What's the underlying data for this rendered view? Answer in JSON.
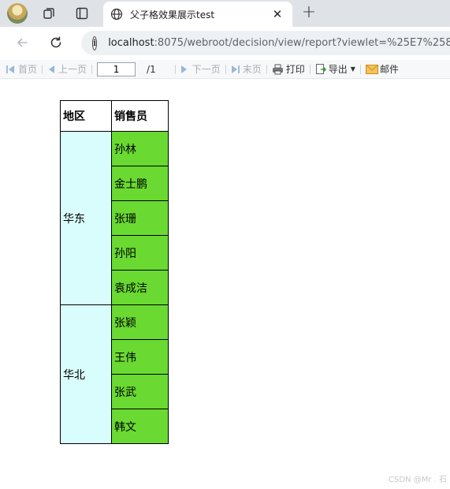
{
  "browser": {
    "tab_title": "父子格效果展示test",
    "tab_close": "✕",
    "new_tab": "+",
    "url_host": "localhost",
    "url_rest": ":8075/webroot/decision/view/report?viewlet=%25E7%2588%"
  },
  "toolbar": {
    "first": "首页",
    "prev": "上一页",
    "page_value": "1",
    "page_total": "/1",
    "next": "下一页",
    "last": "末页",
    "print": "打印",
    "export": "导出",
    "email": "邮件"
  },
  "report": {
    "headers": {
      "region": "地区",
      "seller": "销售员"
    },
    "groups": [
      {
        "region": "华东",
        "sellers": [
          "孙林",
          "金士鹏",
          "张珊",
          "孙阳",
          "袁成洁"
        ]
      },
      {
        "region": "华北",
        "sellers": [
          "张颖",
          "王伟",
          "张武",
          "韩文"
        ]
      }
    ],
    "colors": {
      "region_bg": "#d9fdfd",
      "seller_bg": "#6ad931"
    }
  },
  "watermark": "CSDN @Mr . 石"
}
